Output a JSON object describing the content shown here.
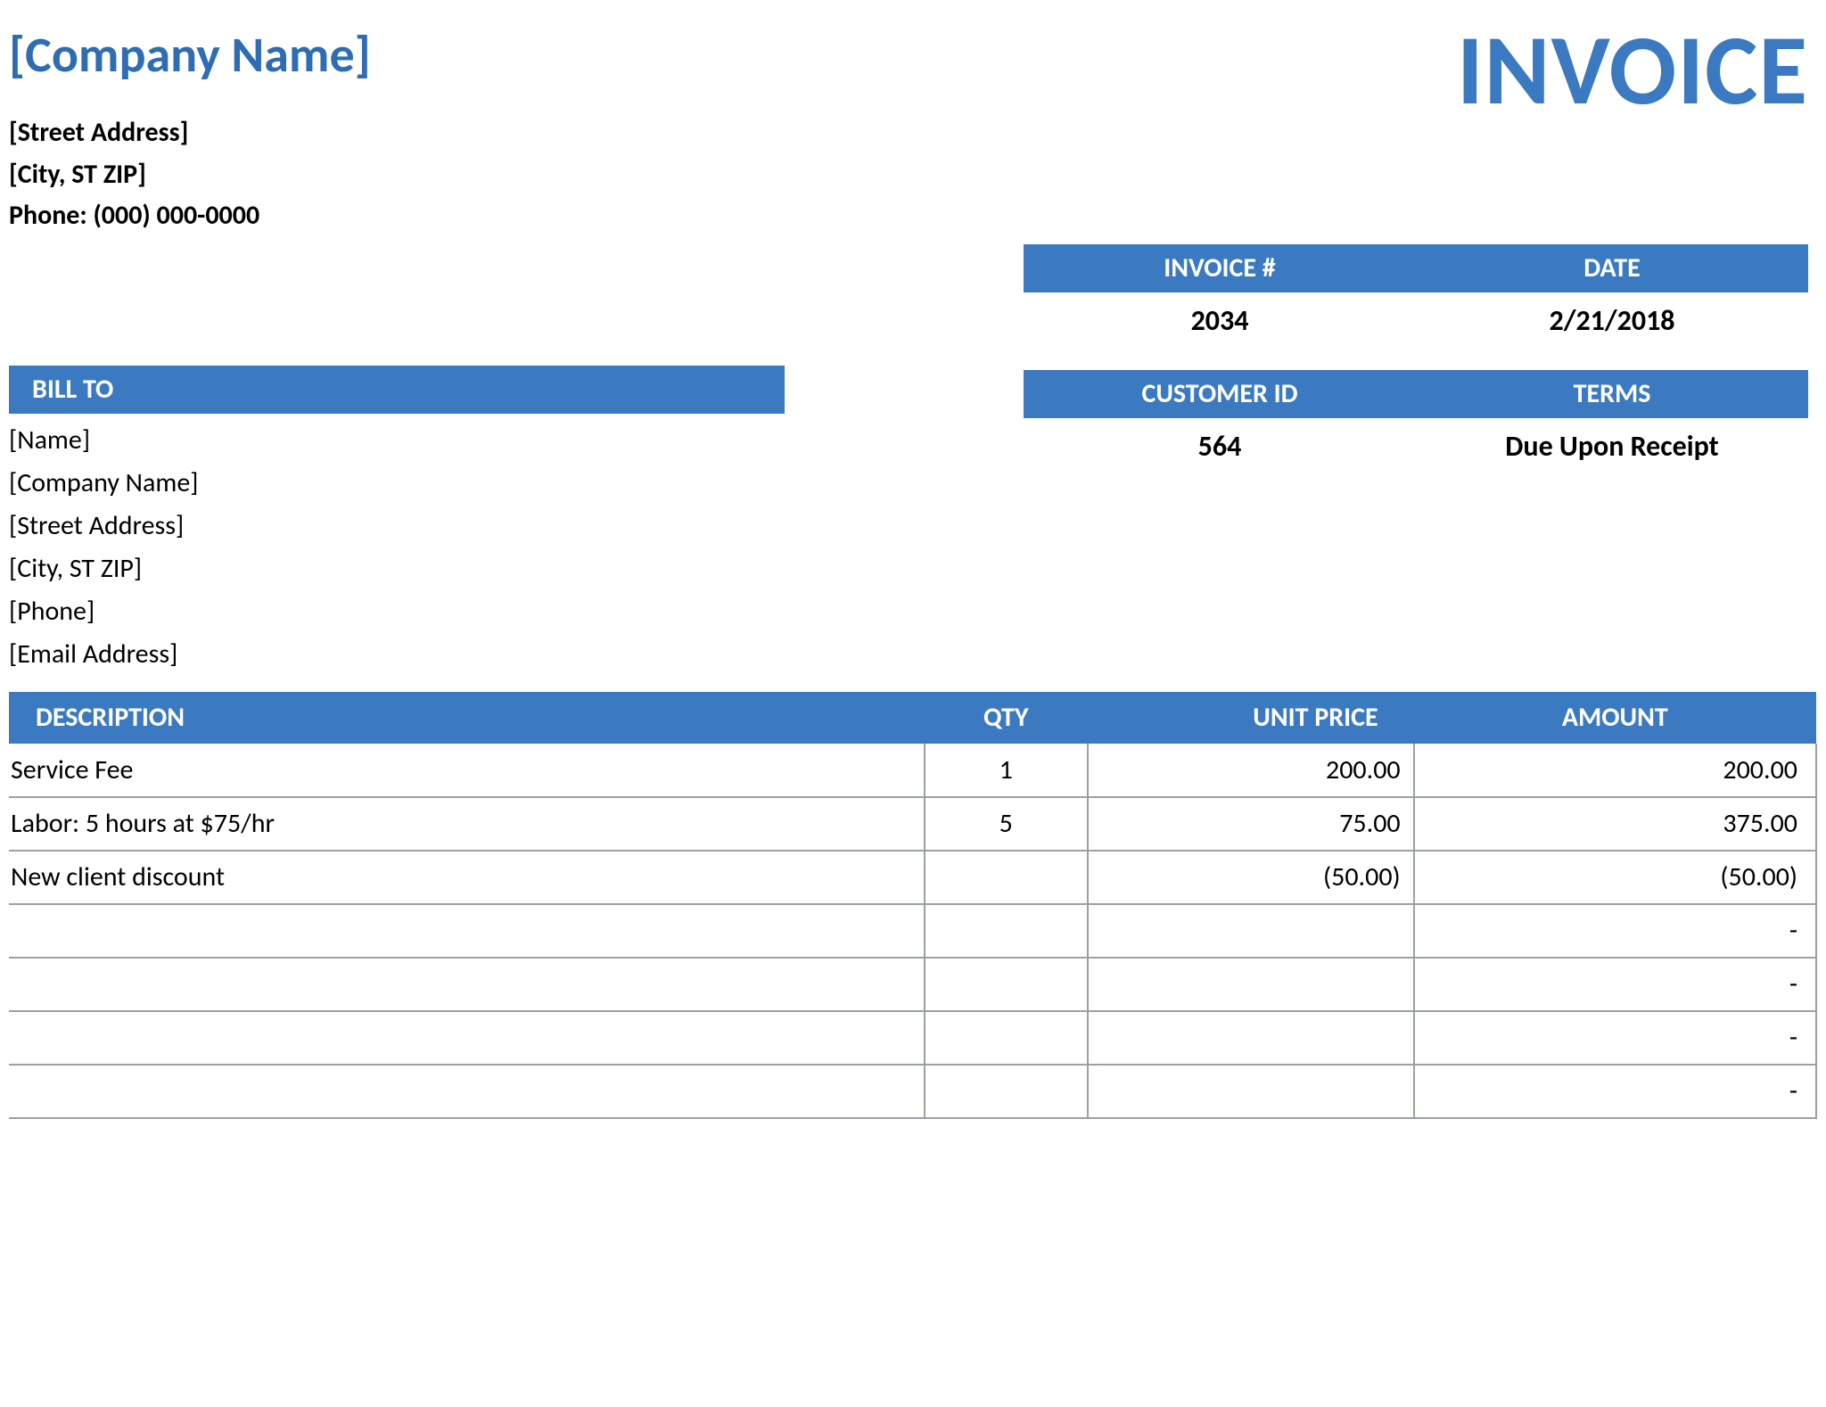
{
  "company": {
    "name": "[Company Name]",
    "street": "[Street Address]",
    "citystzip": "[City, ST  ZIP]",
    "phone": "Phone: (000) 000-0000"
  },
  "doc_title": "INVOICE",
  "meta1": {
    "col1_label": "INVOICE #",
    "col2_label": "DATE",
    "col1_value": "2034",
    "col2_value": "2/21/2018"
  },
  "billto": {
    "header": "BILL TO",
    "lines": {
      "l0": "[Name]",
      "l1": "[Company Name]",
      "l2": "[Street Address]",
      "l3": "[City, ST  ZIP]",
      "l4": "[Phone]",
      "l5": "[Email Address]"
    }
  },
  "meta2": {
    "col1_label": "CUSTOMER ID",
    "col2_label": "TERMS",
    "col1_value": "564",
    "col2_value": "Due Upon Receipt"
  },
  "table": {
    "headers": {
      "desc": "DESCRIPTION",
      "qty": "QTY",
      "unit": "UNIT PRICE",
      "amt": "AMOUNT"
    },
    "rows": {
      "r0": {
        "desc": "Service Fee",
        "qty": "1",
        "unit": "200.00",
        "amt": "200.00"
      },
      "r1": {
        "desc": "Labor: 5 hours at $75/hr",
        "qty": "5",
        "unit": "75.00",
        "amt": "375.00"
      },
      "r2": {
        "desc": "New client discount",
        "qty": "",
        "unit": "(50.00)",
        "amt": "(50.00)"
      },
      "r3": {
        "desc": "",
        "qty": "",
        "unit": "",
        "amt": "-"
      },
      "r4": {
        "desc": "",
        "qty": "",
        "unit": "",
        "amt": "-"
      },
      "r5": {
        "desc": "",
        "qty": "",
        "unit": "",
        "amt": "-"
      },
      "r6": {
        "desc": "",
        "qty": "",
        "unit": "",
        "amt": "-"
      }
    }
  }
}
